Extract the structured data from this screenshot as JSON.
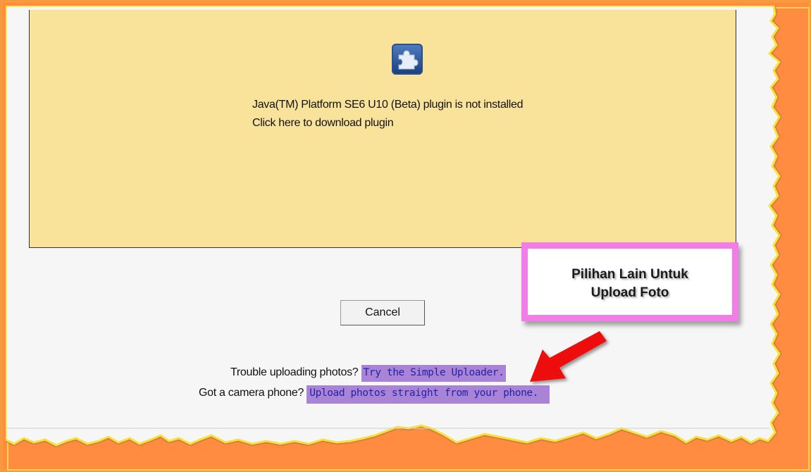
{
  "plugin": {
    "icon": "puzzle-piece-icon",
    "not_installed_text": "Java(TM) Platform SE6 U10 (Beta) plugin is not installed",
    "download_link": "Click here to download plugin"
  },
  "buttons": {
    "cancel_label": "Cancel"
  },
  "callout": {
    "line1": "Pilihan Lain Untuk",
    "line2": "Upload Foto",
    "border_color": "#f37de8",
    "arrow_icon": "red-arrow-icon"
  },
  "help": {
    "trouble_prefix": "Trouble uploading photos?",
    "simple_uploader_link": "Try the Simple Uploader.",
    "phone_prefix": "Got a camera phone?",
    "phone_link": "Upload photos straight from your phone."
  },
  "colors": {
    "frame": "#ff8c40",
    "plugin_background": "#f9e39b",
    "link_highlight": "#a983d6"
  }
}
